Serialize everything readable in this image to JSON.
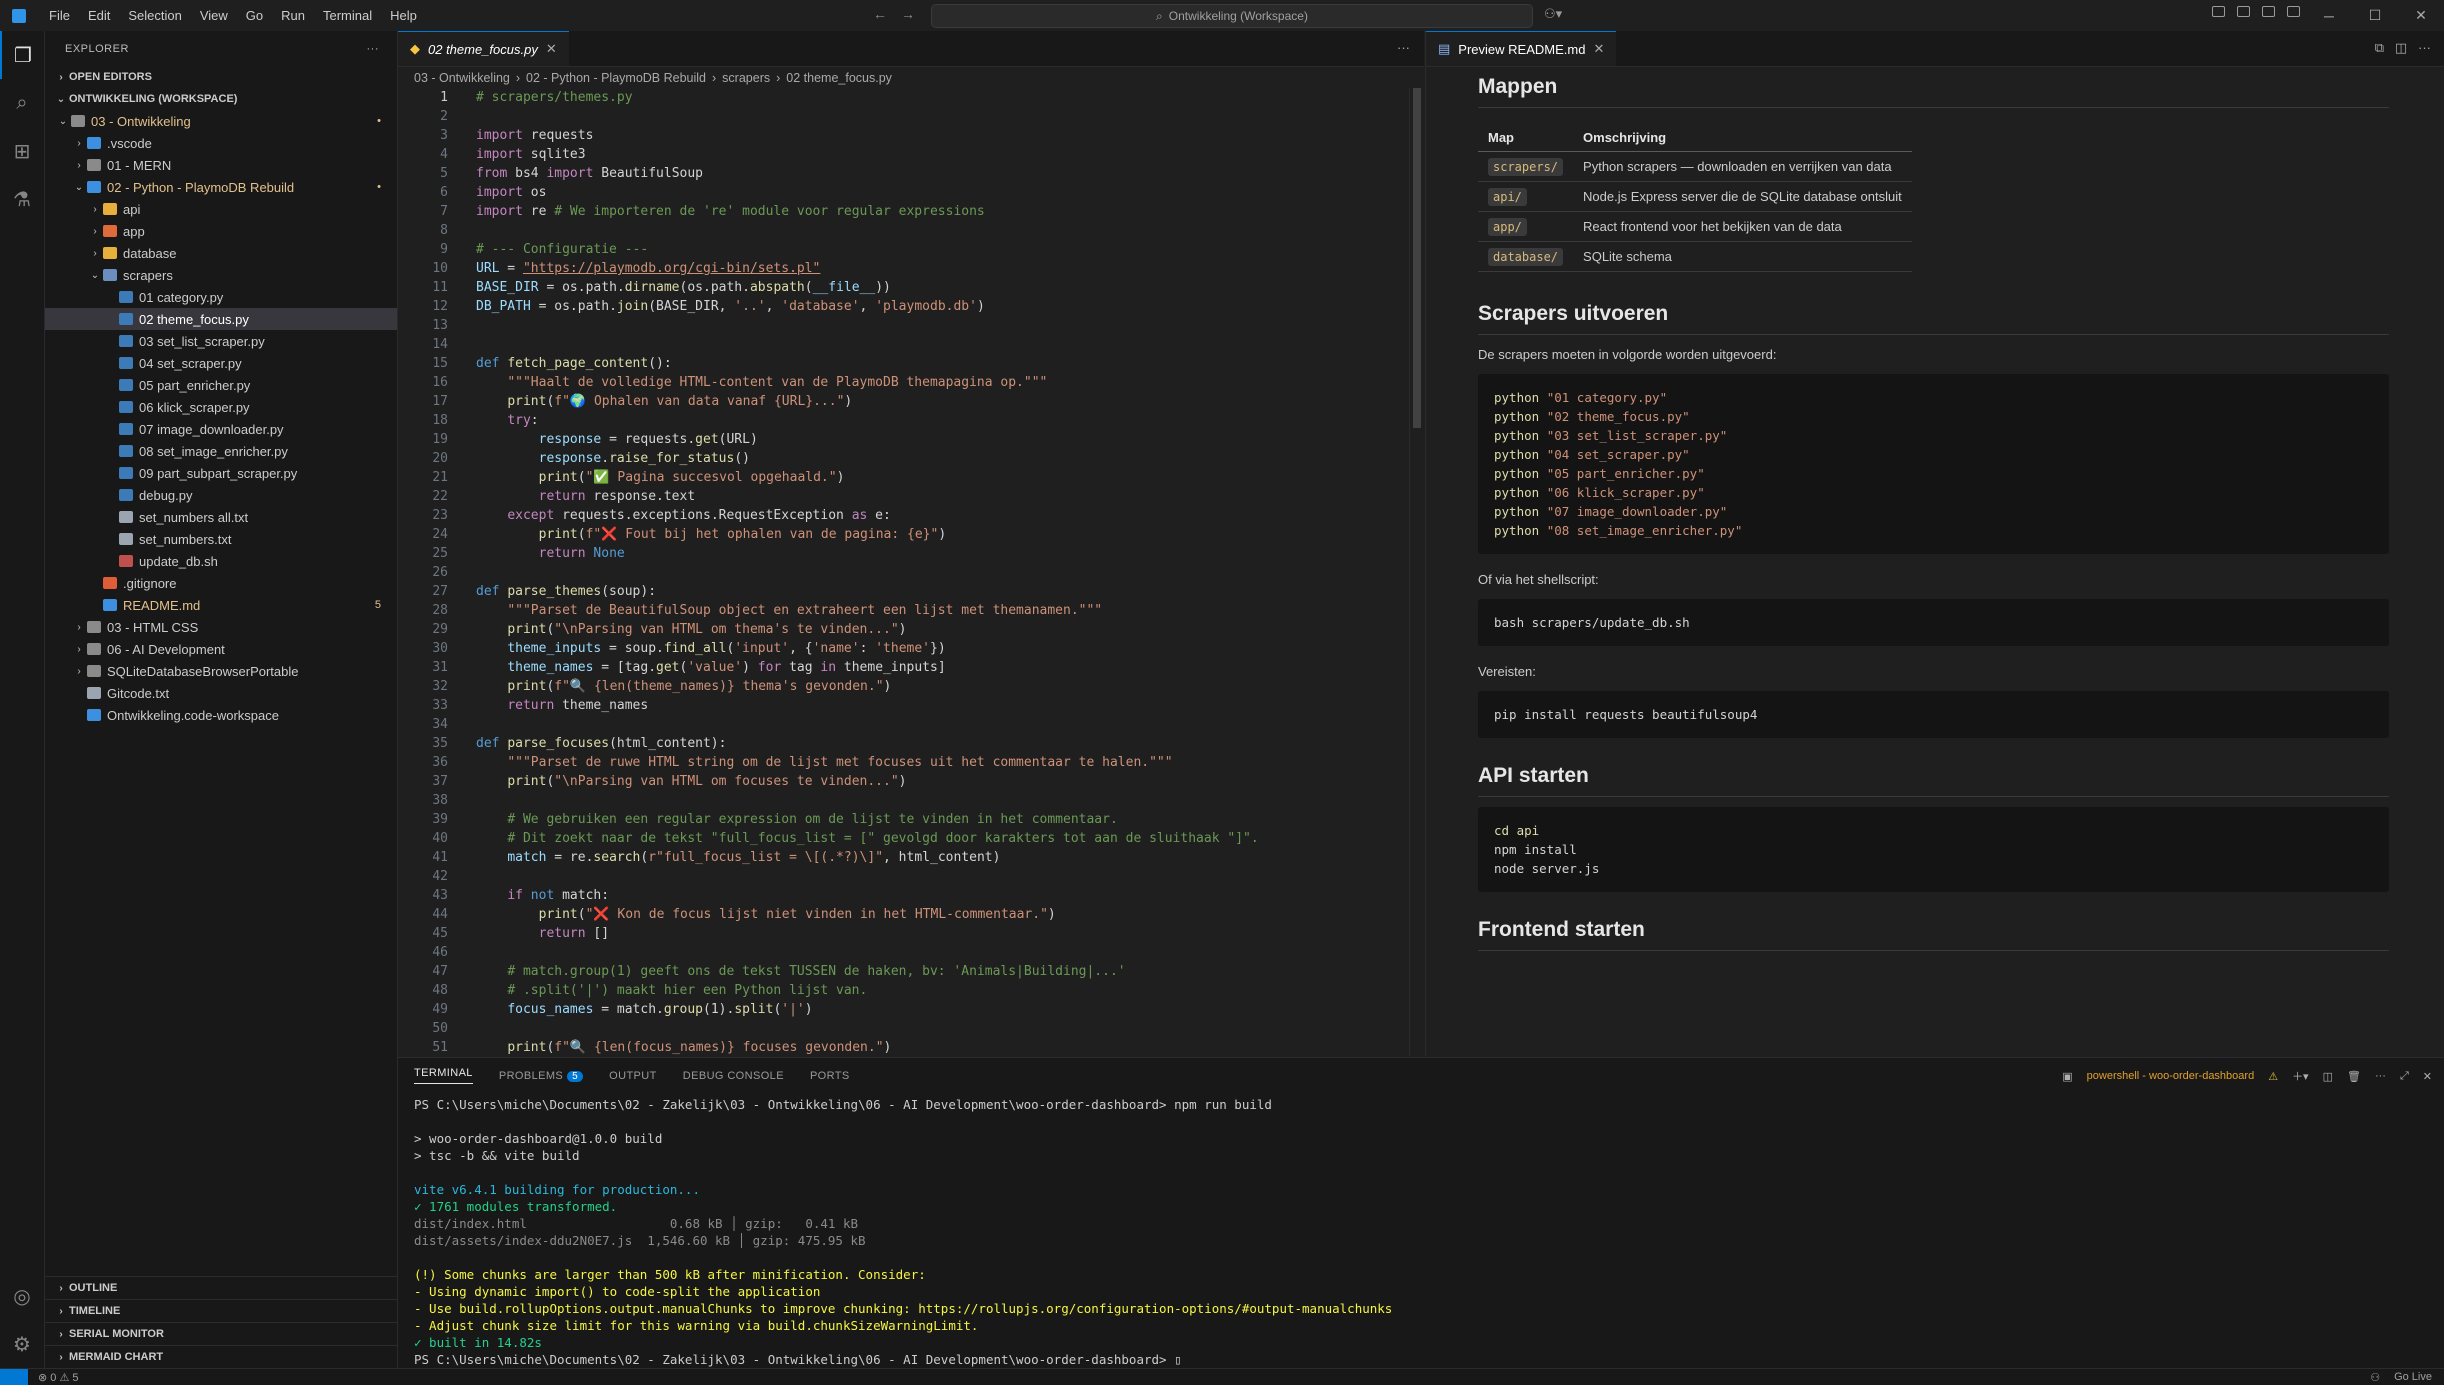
{
  "titlebar": {
    "menu": [
      "File",
      "Edit",
      "Selection",
      "View",
      "Go",
      "Run",
      "Terminal",
      "Help"
    ],
    "search": "Ontwikkeling (Workspace)"
  },
  "sidebar": {
    "title": "EXPLORER",
    "open_editors": "OPEN EDITORS",
    "workspace": "ONTWIKKELING (WORKSPACE)",
    "tree": [
      {
        "label": "03 - Ontwikkeling",
        "depth": 0,
        "chev": "v",
        "color": "#e2c08d",
        "icon": "#8a8a8a",
        "dot": "•"
      },
      {
        "label": ".vscode",
        "depth": 1,
        "chev": ">",
        "color": "#cccccc",
        "icon": "#3d8fe0"
      },
      {
        "label": "01 - MERN",
        "depth": 1,
        "chev": ">",
        "color": "#cccccc",
        "icon": "#8a8a8a"
      },
      {
        "label": "02 - Python - PlaymoDB Rebuild",
        "depth": 1,
        "chev": "v",
        "color": "#e2c08d",
        "icon": "#3d8fe0",
        "dot": "•"
      },
      {
        "label": "api",
        "depth": 2,
        "chev": ">",
        "color": "#cccccc",
        "icon": "#e8b03a"
      },
      {
        "label": "app",
        "depth": 2,
        "chev": ">",
        "color": "#cccccc",
        "icon": "#e06b3a"
      },
      {
        "label": "database",
        "depth": 2,
        "chev": ">",
        "color": "#cccccc",
        "icon": "#e8b03a"
      },
      {
        "label": "scrapers",
        "depth": 2,
        "chev": "v",
        "color": "#cccccc",
        "icon": "#6a8fbf"
      },
      {
        "label": "01 category.py",
        "depth": 3,
        "chev": "",
        "color": "#cccccc",
        "icon": "#3d7ab8"
      },
      {
        "label": "02 theme_focus.py",
        "depth": 3,
        "chev": "",
        "color": "#ffffff",
        "icon": "#3d7ab8",
        "selected": true
      },
      {
        "label": "03 set_list_scraper.py",
        "depth": 3,
        "chev": "",
        "color": "#cccccc",
        "icon": "#3d7ab8"
      },
      {
        "label": "04 set_scraper.py",
        "depth": 3,
        "chev": "",
        "color": "#cccccc",
        "icon": "#3d7ab8"
      },
      {
        "label": "05 part_enricher.py",
        "depth": 3,
        "chev": "",
        "color": "#cccccc",
        "icon": "#3d7ab8"
      },
      {
        "label": "06 klick_scraper.py",
        "depth": 3,
        "chev": "",
        "color": "#cccccc",
        "icon": "#3d7ab8"
      },
      {
        "label": "07 image_downloader.py",
        "depth": 3,
        "chev": "",
        "color": "#cccccc",
        "icon": "#3d7ab8"
      },
      {
        "label": "08 set_image_enricher.py",
        "depth": 3,
        "chev": "",
        "color": "#cccccc",
        "icon": "#3d7ab8"
      },
      {
        "label": "09 part_subpart_scraper.py",
        "depth": 3,
        "chev": "",
        "color": "#cccccc",
        "icon": "#3d7ab8"
      },
      {
        "label": "debug.py",
        "depth": 3,
        "chev": "",
        "color": "#cccccc",
        "icon": "#3d7ab8"
      },
      {
        "label": "set_numbers all.txt",
        "depth": 3,
        "chev": "",
        "color": "#cccccc",
        "icon": "#9aa5b1"
      },
      {
        "label": "set_numbers.txt",
        "depth": 3,
        "chev": "",
        "color": "#cccccc",
        "icon": "#9aa5b1"
      },
      {
        "label": "update_db.sh",
        "depth": 3,
        "chev": "",
        "color": "#cccccc",
        "icon": "#c0504d"
      },
      {
        "label": ".gitignore",
        "depth": 2,
        "chev": "",
        "color": "#cccccc",
        "icon": "#e05d3a"
      },
      {
        "label": "README.md",
        "depth": 2,
        "chev": "",
        "color": "#e2c08d",
        "icon": "#3d8fe0",
        "dot": "5"
      },
      {
        "label": "03 - HTML CSS",
        "depth": 1,
        "chev": ">",
        "color": "#cccccc",
        "icon": "#8a8a8a"
      },
      {
        "label": "06 - AI Development",
        "depth": 1,
        "chev": ">",
        "color": "#cccccc",
        "icon": "#8a8a8a"
      },
      {
        "label": "SQLiteDatabaseBrowserPortable",
        "depth": 1,
        "chev": ">",
        "color": "#cccccc",
        "icon": "#8a8a8a"
      },
      {
        "label": "Gitcode.txt",
        "depth": 1,
        "chev": "",
        "color": "#cccccc",
        "icon": "#9aa5b1"
      },
      {
        "label": "Ontwikkeling.code-workspace",
        "depth": 1,
        "chev": "",
        "color": "#cccccc",
        "icon": "#3d8fe0"
      }
    ],
    "bottom_sections": [
      "OUTLINE",
      "TIMELINE",
      "SERIAL MONITOR",
      "MERMAID CHART"
    ]
  },
  "editor": {
    "tab_label": "02 theme_focus.py",
    "breadcrumb": [
      "03 - Ontwikkeling",
      "02 - Python - PlaymoDB Rebuild",
      "scrapers",
      "02 theme_focus.py"
    ]
  },
  "code_lines": [
    [
      [
        "cm",
        "# scrapers/themes.py"
      ]
    ],
    [],
    [
      [
        "kw",
        "import"
      ],
      [
        "op",
        " requests"
      ]
    ],
    [
      [
        "kw",
        "import"
      ],
      [
        "op",
        " sqlite3"
      ]
    ],
    [
      [
        "kw",
        "from"
      ],
      [
        "op",
        " bs4 "
      ],
      [
        "kw",
        "import"
      ],
      [
        "op",
        " BeautifulSoup"
      ]
    ],
    [
      [
        "kw",
        "import"
      ],
      [
        "op",
        " os"
      ]
    ],
    [
      [
        "kw",
        "import"
      ],
      [
        "op",
        " re "
      ],
      [
        "cm",
        "# We importeren de 're' module voor regular expressions"
      ]
    ],
    [],
    [
      [
        "cm",
        "# --- Configuratie ---"
      ]
    ],
    [
      [
        "var",
        "URL"
      ],
      [
        "op",
        " = "
      ],
      [
        "url",
        "\"https://playmodb.org/cgi-bin/sets.pl\""
      ]
    ],
    [
      [
        "var",
        "BASE_DIR"
      ],
      [
        "op",
        " = os.path."
      ],
      [
        "fn",
        "dirname"
      ],
      [
        "op",
        "(os.path."
      ],
      [
        "fn",
        "abspath"
      ],
      [
        "op",
        "("
      ],
      [
        "var",
        "__file__"
      ],
      [
        "op",
        "))"
      ]
    ],
    [
      [
        "var",
        "DB_PATH"
      ],
      [
        "op",
        " = os.path."
      ],
      [
        "fn",
        "join"
      ],
      [
        "op",
        "(BASE_DIR, "
      ],
      [
        "str",
        "'..'"
      ],
      [
        "op",
        ", "
      ],
      [
        "str",
        "'database'"
      ],
      [
        "op",
        ", "
      ],
      [
        "str",
        "'playmodb.db'"
      ],
      [
        "op",
        ")"
      ]
    ],
    [],
    [],
    [
      [
        "kwb",
        "def"
      ],
      [
        "op",
        " "
      ],
      [
        "fn",
        "fetch_page_content"
      ],
      [
        "op",
        "():"
      ]
    ],
    [
      [
        "op",
        "    "
      ],
      [
        "str",
        "\"\"\"Haalt de volledige HTML-content van de PlaymoDB themapagina op.\"\"\""
      ]
    ],
    [
      [
        "op",
        "    "
      ],
      [
        "fn",
        "print"
      ],
      [
        "op",
        "("
      ],
      [
        "str",
        "f\"🌍 Ophalen van data vanaf {URL}...\""
      ],
      [
        "op",
        ")"
      ]
    ],
    [
      [
        "op",
        "    "
      ],
      [
        "kw",
        "try"
      ],
      [
        "op",
        ":"
      ]
    ],
    [
      [
        "op",
        "        "
      ],
      [
        "var",
        "response"
      ],
      [
        "op",
        " = requests."
      ],
      [
        "fn",
        "get"
      ],
      [
        "op",
        "(URL)"
      ]
    ],
    [
      [
        "op",
        "        "
      ],
      [
        "var",
        "response"
      ],
      [
        "op",
        "."
      ],
      [
        "fn",
        "raise_for_status"
      ],
      [
        "op",
        "()"
      ]
    ],
    [
      [
        "op",
        "        "
      ],
      [
        "fn",
        "print"
      ],
      [
        "op",
        "("
      ],
      [
        "str",
        "\"✅ Pagina succesvol opgehaald.\""
      ],
      [
        "op",
        ")"
      ]
    ],
    [
      [
        "op",
        "        "
      ],
      [
        "kw",
        "return"
      ],
      [
        "op",
        " response.text"
      ]
    ],
    [
      [
        "op",
        "    "
      ],
      [
        "kw",
        "except"
      ],
      [
        "op",
        " requests.exceptions.RequestException "
      ],
      [
        "kw",
        "as"
      ],
      [
        "op",
        " e:"
      ]
    ],
    [
      [
        "op",
        "        "
      ],
      [
        "fn",
        "print"
      ],
      [
        "op",
        "("
      ],
      [
        "str",
        "f\"❌ Fout bij het ophalen van de pagina: {e}\""
      ],
      [
        "op",
        ")"
      ]
    ],
    [
      [
        "op",
        "        "
      ],
      [
        "kw",
        "return"
      ],
      [
        "op",
        " "
      ],
      [
        "kwb",
        "None"
      ]
    ],
    [],
    [
      [
        "kwb",
        "def"
      ],
      [
        "op",
        " "
      ],
      [
        "fn",
        "parse_themes"
      ],
      [
        "op",
        "(soup):"
      ]
    ],
    [
      [
        "op",
        "    "
      ],
      [
        "str",
        "\"\"\"Parset de BeautifulSoup object en extraheert een lijst met themanamen.\"\"\""
      ]
    ],
    [
      [
        "op",
        "    "
      ],
      [
        "fn",
        "print"
      ],
      [
        "op",
        "("
      ],
      [
        "str",
        "\"\\nParsing van HTML om thema's te vinden...\""
      ],
      [
        "op",
        ")"
      ]
    ],
    [
      [
        "op",
        "    "
      ],
      [
        "var",
        "theme_inputs"
      ],
      [
        "op",
        " = soup."
      ],
      [
        "fn",
        "find_all"
      ],
      [
        "op",
        "("
      ],
      [
        "str",
        "'input'"
      ],
      [
        "op",
        ", {"
      ],
      [
        "str",
        "'name'"
      ],
      [
        "op",
        ": "
      ],
      [
        "str",
        "'theme'"
      ],
      [
        "op",
        "})"
      ]
    ],
    [
      [
        "op",
        "    "
      ],
      [
        "var",
        "theme_names"
      ],
      [
        "op",
        " = [tag."
      ],
      [
        "fn",
        "get"
      ],
      [
        "op",
        "("
      ],
      [
        "str",
        "'value'"
      ],
      [
        "op",
        ") "
      ],
      [
        "kw",
        "for"
      ],
      [
        "op",
        " tag "
      ],
      [
        "kw",
        "in"
      ],
      [
        "op",
        " theme_inputs]"
      ]
    ],
    [
      [
        "op",
        "    "
      ],
      [
        "fn",
        "print"
      ],
      [
        "op",
        "("
      ],
      [
        "str",
        "f\"🔍 {len(theme_names)} thema's gevonden.\""
      ],
      [
        "op",
        ")"
      ]
    ],
    [
      [
        "op",
        "    "
      ],
      [
        "kw",
        "return"
      ],
      [
        "op",
        " theme_names"
      ]
    ],
    [],
    [
      [
        "kwb",
        "def"
      ],
      [
        "op",
        " "
      ],
      [
        "fn",
        "parse_focuses"
      ],
      [
        "op",
        "(html_content):"
      ]
    ],
    [
      [
        "op",
        "    "
      ],
      [
        "str",
        "\"\"\"Parset de ruwe HTML string om de lijst met focuses uit het commentaar te halen.\"\"\""
      ]
    ],
    [
      [
        "op",
        "    "
      ],
      [
        "fn",
        "print"
      ],
      [
        "op",
        "("
      ],
      [
        "str",
        "\"\\nParsing van HTML om focuses te vinden...\""
      ],
      [
        "op",
        ")"
      ]
    ],
    [],
    [
      [
        "op",
        "    "
      ],
      [
        "cm",
        "# We gebruiken een regular expression om de lijst te vinden in het commentaar."
      ]
    ],
    [
      [
        "op",
        "    "
      ],
      [
        "cm",
        "# Dit zoekt naar de tekst \"full_focus_list = [\" gevolgd door karakters tot aan de sluithaak \"]\"."
      ]
    ],
    [
      [
        "op",
        "    "
      ],
      [
        "var",
        "match"
      ],
      [
        "op",
        " = re."
      ],
      [
        "fn",
        "search"
      ],
      [
        "op",
        "("
      ],
      [
        "str",
        "r\"full_focus_list = \\[(.*?)\\]\""
      ],
      [
        "op",
        ", html_content)"
      ]
    ],
    [],
    [
      [
        "op",
        "    "
      ],
      [
        "kw",
        "if"
      ],
      [
        "op",
        " "
      ],
      [
        "kwb",
        "not"
      ],
      [
        "op",
        " match:"
      ]
    ],
    [
      [
        "op",
        "        "
      ],
      [
        "fn",
        "print"
      ],
      [
        "op",
        "("
      ],
      [
        "str",
        "\"❌ Kon de focus lijst niet vinden in het HTML-commentaar.\""
      ],
      [
        "op",
        ")"
      ]
    ],
    [
      [
        "op",
        "        "
      ],
      [
        "kw",
        "return"
      ],
      [
        "op",
        " []"
      ]
    ],
    [],
    [
      [
        "op",
        "    "
      ],
      [
        "cm",
        "# match.group(1) geeft ons de tekst TUSSEN de haken, bv: 'Animals|Building|...'"
      ]
    ],
    [
      [
        "op",
        "    "
      ],
      [
        "cm",
        "# .split('|') maakt hier een Python lijst van."
      ]
    ],
    [
      [
        "op",
        "    "
      ],
      [
        "var",
        "focus_names"
      ],
      [
        "op",
        " = match."
      ],
      [
        "fn",
        "group"
      ],
      [
        "op",
        "(1)."
      ],
      [
        "fn",
        "split"
      ],
      [
        "op",
        "("
      ],
      [
        "str",
        "'|'"
      ],
      [
        "op",
        ")"
      ]
    ],
    [],
    [
      [
        "op",
        "    "
      ],
      [
        "fn",
        "print"
      ],
      [
        "op",
        "("
      ],
      [
        "str",
        "f\"🔍 {len(focus_names)} focuses gevonden.\""
      ],
      [
        "op",
        ")"
      ]
    ]
  ],
  "preview": {
    "tab_label": "Preview README.md",
    "h_folders": "Mappen",
    "table_headers": [
      "Map",
      "Omschrijving"
    ],
    "table_rows": [
      [
        "scrapers/",
        "Python scrapers — downloaden en verrijken van data"
      ],
      [
        "api/",
        "Node.js Express server die de SQLite database ontsluit"
      ],
      [
        "app/",
        "React frontend voor het bekijken van de data"
      ],
      [
        "database/",
        "SQLite schema"
      ]
    ],
    "h_scrapers": "Scrapers uitvoeren",
    "p_order": "De scrapers moeten in volgorde worden uitgevoerd:",
    "scraper_cmds": [
      "\"01 category.py\"",
      "\"02 theme_focus.py\"",
      "\"03 set_list_scraper.py\"",
      "\"04 set_scraper.py\"",
      "\"05 part_enricher.py\"",
      "\"06 klick_scraper.py\"",
      "\"07 image_downloader.py\"",
      "\"08 set_image_enricher.py\""
    ],
    "cmd_prefix": "python ",
    "p_shell": "Of via het shellscript:",
    "shell_cmd": "bash scrapers/update_db.sh",
    "p_req": "Vereisten:",
    "pip_cmd": "pip install requests beautifulsoup4",
    "h_api": "API starten",
    "api_cmds": [
      "cd api",
      "npm install",
      "node server.js"
    ],
    "h_frontend": "Frontend starten"
  },
  "panel": {
    "tabs": [
      "TERMINAL",
      "PROBLEMS",
      "OUTPUT",
      "DEBUG CONSOLE",
      "PORTS"
    ],
    "problems_count": "5",
    "terminal_name": "powershell - woo-order-dashboard",
    "lines": [
      {
        "c": "",
        "t": "PS C:\\Users\\miche\\Documents\\02 - Zakelijk\\03 - Ontwikkeling\\06 - AI Development\\woo-order-dashboard> npm run build"
      },
      {
        "c": "",
        "t": ""
      },
      {
        "c": "",
        "t": "> woo-order-dashboard@1.0.0 build"
      },
      {
        "c": "",
        "t": "> tsc -b && vite build"
      },
      {
        "c": "",
        "t": ""
      },
      {
        "c": "t-cyan",
        "t": "vite v6.4.1 building for production..."
      },
      {
        "c": "t-green",
        "t": "✓ 1761 modules transformed."
      },
      {
        "c": "t-dim",
        "t": "dist/index.html                   0.68 kB │ gzip:   0.41 kB"
      },
      {
        "c": "t-dim",
        "t": "dist/assets/index-ddu2N0E7.js  1,546.60 kB │ gzip: 475.95 kB"
      },
      {
        "c": "",
        "t": ""
      },
      {
        "c": "t-yellow",
        "t": "(!) Some chunks are larger than 500 kB after minification. Consider:"
      },
      {
        "c": "t-yellow",
        "t": "- Using dynamic import() to code-split the application"
      },
      {
        "c": "t-yellow",
        "t": "- Use build.rollupOptions.output.manualChunks to improve chunking: https://rollupjs.org/configuration-options/#output-manualchunks"
      },
      {
        "c": "t-yellow",
        "t": "- Adjust chunk size limit for this warning via build.chunkSizeWarningLimit."
      },
      {
        "c": "t-green",
        "t": "✓ built in 14.82s"
      },
      {
        "c": "",
        "t": "PS C:\\Users\\miche\\Documents\\02 - Zakelijk\\03 - Ontwikkeling\\06 - AI Development\\woo-order-dashboard> ▯"
      }
    ]
  },
  "status": {
    "left": "⊗ 0 ⚠ 5",
    "right": "Go Live"
  }
}
